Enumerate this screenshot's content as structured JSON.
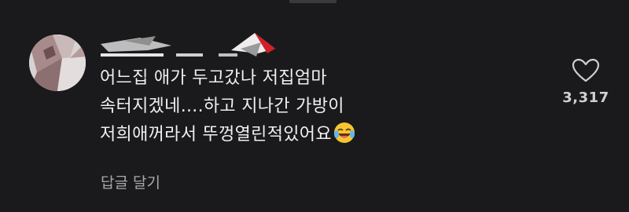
{
  "comment": {
    "lines": [
      "어느집 애가 두고갔나 저집엄마",
      "속터지겠네....하고 지나간 가방이",
      "저희애꺼라서 뚜껑열린적있어요"
    ],
    "emoji": "laughing-tears-emoji",
    "reply_label": "답글 달기",
    "like_count": "3,317",
    "username_redacted": true
  },
  "icons": {
    "heart": "heart-outline-icon",
    "avatar": "user-avatar-image"
  },
  "colors": {
    "background": "#1a1a1c",
    "text": "#f0f0f0",
    "muted": "#a8a8a8"
  }
}
